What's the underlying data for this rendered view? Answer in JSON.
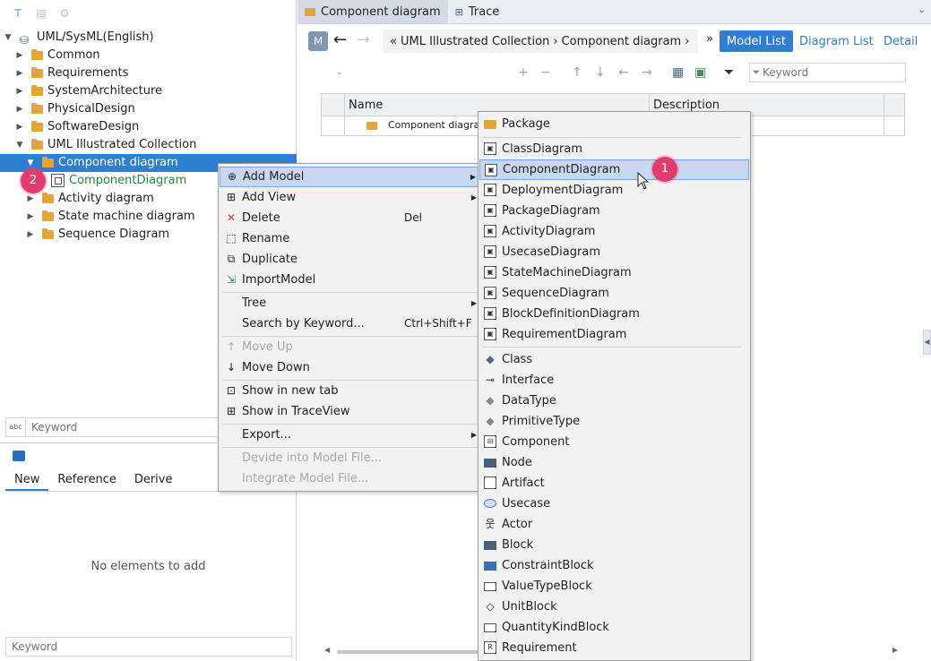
{
  "left_panel": {
    "tree": {
      "root": "UML/SysML(English)",
      "folders": [
        "Common",
        "Requirements",
        "SystemArchitecture",
        "PhysicalDesign",
        "SoftwareDesign",
        "UML Illustrated Collection"
      ],
      "uml_children": [
        "Component diagram",
        "Activity diagram",
        "State machine diagram",
        "Sequence Diagram"
      ],
      "selected_child_item": "ComponentDiagram"
    },
    "search_placeholder": "Keyword",
    "search_abc": "abc",
    "bottom": {
      "tabs": [
        "New",
        "Reference",
        "Derive"
      ],
      "empty_text": "No elements to add",
      "search_placeholder": "Keyword"
    }
  },
  "tabs": [
    "Component diagram",
    "Trace"
  ],
  "nav": {
    "badge": "M",
    "breadcrumb": [
      "UML Illustrated Collection",
      "Component diagram"
    ],
    "bc_prefix": "«",
    "bc_sep": "›",
    "bc_more": "»",
    "model_list": "Model List",
    "diagram_list": "Diagram List",
    "detail": "Detail",
    "keyword_placeholder": "Keyword"
  },
  "grid": {
    "columns": [
      "Name",
      "Description"
    ],
    "rows": [
      {
        "name": "Component diagram"
      }
    ]
  },
  "context_menu": {
    "add_model": "Add Model",
    "add_view": "Add View",
    "delete": "Delete",
    "delete_shortcut": "Del",
    "rename": "Rename",
    "duplicate": "Duplicate",
    "import_model": "ImportModel",
    "tree": "Tree",
    "search_by_keyword": "Search by Keyword...",
    "search_shortcut": "Ctrl+Shift+F",
    "move_up": "Move Up",
    "move_down": "Move Down",
    "show_new_tab": "Show in new tab",
    "show_traceview": "Show in TraceView",
    "export": "Export...",
    "devide": "Devide into Model File...",
    "integrate": "Integrate Model File..."
  },
  "submenu": {
    "package": "Package",
    "diagrams": [
      "ClassDiagram",
      "ComponentDiagram",
      "DeploymentDiagram",
      "PackageDiagram",
      "ActivityDiagram",
      "UsecaseDiagram",
      "StateMachineDiagram",
      "SequenceDiagram",
      "BlockDefinitionDiagram",
      "RequirementDiagram"
    ],
    "elements": [
      "Class",
      "Interface",
      "DataType",
      "PrimitiveType",
      "Component",
      "Node",
      "Artifact",
      "Usecase",
      "Actor",
      "Block",
      "ConstraintBlock",
      "ValueTypeBlock",
      "UnitBlock",
      "QuantityKindBlock",
      "Requirement"
    ]
  },
  "callouts": [
    "1",
    "2"
  ],
  "colors": {
    "accent": "#2e7ed1",
    "callout": "#e23c6e",
    "folder": "#e3a43a",
    "highlight": "#c6d9f1"
  }
}
